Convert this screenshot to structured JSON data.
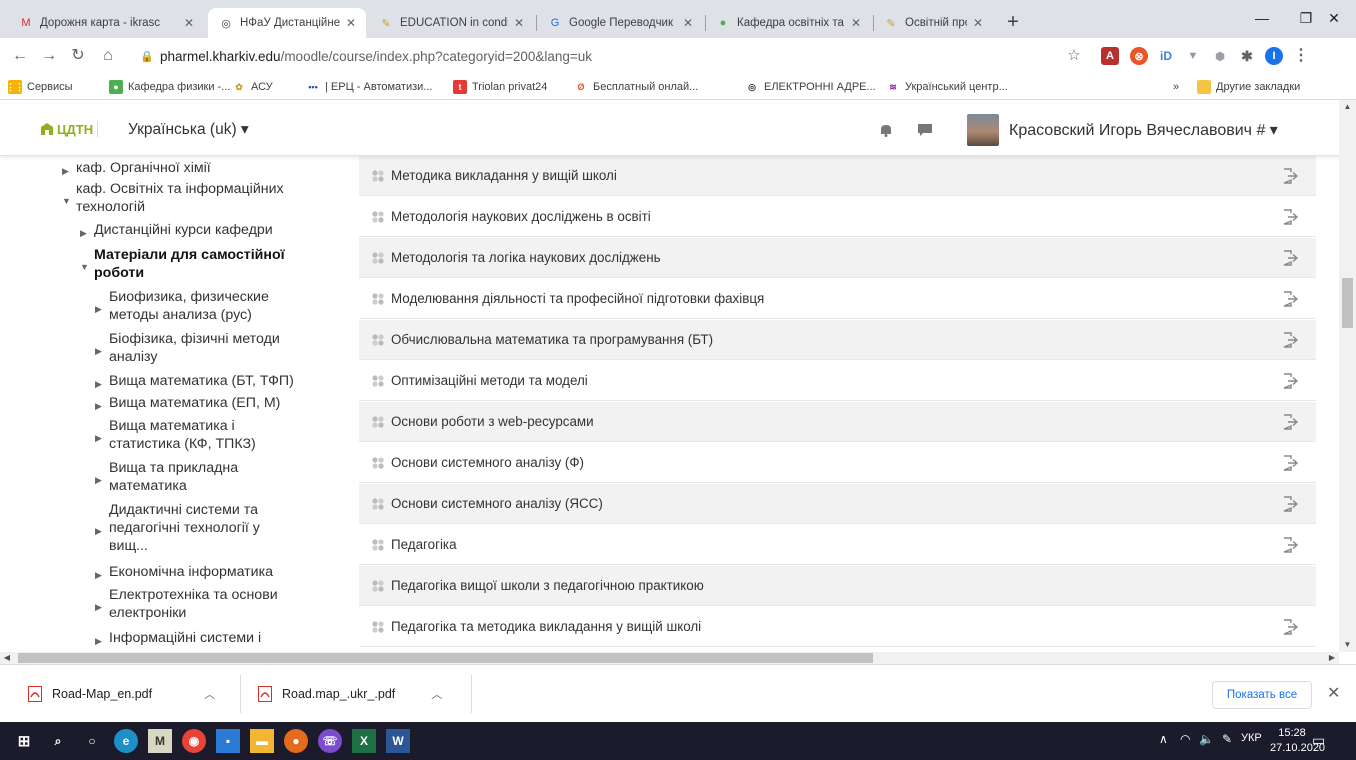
{
  "browser": {
    "tabs": [
      {
        "title": "Дорожня карта - ikrasc",
        "favicon": "gmail-icon",
        "active": false
      },
      {
        "title": "НФаУ Дистанційне нав",
        "favicon": "globe-icon",
        "active": true
      },
      {
        "title": "EDUCATION in conditio",
        "favicon": "pencil-icon",
        "active": false
      },
      {
        "title": "Google Переводчик",
        "favicon": "translate-icon",
        "active": false
      },
      {
        "title": "Кафедра освітніх та інс",
        "favicon": "green-orb-icon",
        "active": false
      },
      {
        "title": "Освітній процес в умо",
        "favicon": "pencil-icon",
        "active": false
      }
    ],
    "url_host": "pharmel.kharkiv.edu",
    "url_path": "/moodle/course/index.php?categoryid=200&lang=uk",
    "bookmarks": [
      {
        "label": "Сервисы",
        "icon": "apps-grid-icon"
      },
      {
        "label": "Кафедра физики -...",
        "icon": "green-orb-icon"
      },
      {
        "label": "АСУ",
        "icon": "asu-icon"
      },
      {
        "label": "| ЕРЦ - Автоматизи...",
        "icon": "dots-icon"
      },
      {
        "label": "Triolan privat24",
        "icon": "triolan-icon"
      },
      {
        "label": "Бесплатный онлай...",
        "icon": "online-icon"
      },
      {
        "label": "ЕЛЕКТРОННІ АДРЕ...",
        "icon": "globe-icon"
      },
      {
        "label": "Український центр...",
        "icon": "flag-icon"
      }
    ],
    "bookmarks_more": "»",
    "other_bookmarks": "Другие закладки"
  },
  "moodle": {
    "logo_text": "ЦДТН",
    "language": "Українська (uk) ▾",
    "user_name": "Красовский Игорь Вячеславович # ▾"
  },
  "tree": [
    {
      "label": "каф. Органічної хімії",
      "twisty": "▶",
      "bold": false
    },
    {
      "label": "каф. Освітніх та інформаційних\nтехнологій",
      "twisty": "▼",
      "bold": false
    },
    {
      "label": "Дистанційні курси кафедри",
      "twisty": "▶",
      "bold": false
    },
    {
      "label": "Матеріали для самостійної\nроботи",
      "twisty": "▼",
      "bold": true
    },
    {
      "label": "Биофизика, физические\nметоды анализа (рус)",
      "twisty": "▶",
      "bold": false
    },
    {
      "label": "Біофізика, фізичні методи\nаналізу",
      "twisty": "▶",
      "bold": false
    },
    {
      "label": "Вища математика (БТ, ТФП)",
      "twisty": "▶",
      "bold": false
    },
    {
      "label": "Вища математика (ЕП, М)",
      "twisty": "▶",
      "bold": false
    },
    {
      "label": "Вища математика і\nстатистика (КФ, ТПКЗ)",
      "twisty": "▶",
      "bold": false
    },
    {
      "label": "Вища та прикладна\nматематика",
      "twisty": "▶",
      "bold": false
    },
    {
      "label": "Дидактичні системи та\nпедагогічні технології у\nвищ...",
      "twisty": "▶",
      "bold": false
    },
    {
      "label": "Економічна інформатика",
      "twisty": "▶",
      "bold": false
    },
    {
      "label": "Електротехніка та основи\nелектроніки",
      "twisty": "▶",
      "bold": false
    },
    {
      "label": "Інформаційні системи і",
      "twisty": "▶",
      "bold": false
    }
  ],
  "courses": [
    {
      "name": "Методика викладання у вищій школі",
      "enrol": true
    },
    {
      "name": "Методологія наукових досліджень в освіті",
      "enrol": true
    },
    {
      "name": "Методологія та логіка наукових досліджень",
      "enrol": true
    },
    {
      "name": "Моделювання діяльності та професійної підготовки фахівця",
      "enrol": true
    },
    {
      "name": "Обчислювальна математика та програмування (БТ)",
      "enrol": true
    },
    {
      "name": "Оптимізаційні методи та моделі",
      "enrol": true
    },
    {
      "name": "Основи роботи з web-ресурсами",
      "enrol": true
    },
    {
      "name": "Основи системного аналізу (Ф)",
      "enrol": true
    },
    {
      "name": "Основи системного аналізу (ЯСС)",
      "enrol": true
    },
    {
      "name": "Педагогіка",
      "enrol": true
    },
    {
      "name": "Педагогіка вищої школи з педагогічною практикою",
      "enrol": false
    },
    {
      "name": "Педагогіка та методика викладання у вищій школі",
      "enrol": true
    }
  ],
  "downloads": [
    {
      "name": "Road-Map_en.pdf"
    },
    {
      "name": "Road.map_.ukr_.pdf"
    }
  ],
  "show_all": "Показать все",
  "taskbar": {
    "lang": "УКР",
    "time": "15:28",
    "date": "27.10.2020"
  },
  "colors": {
    "accent": "#8fb01e",
    "link": "#1a73e8",
    "taskbar": "#1b1b2b"
  }
}
